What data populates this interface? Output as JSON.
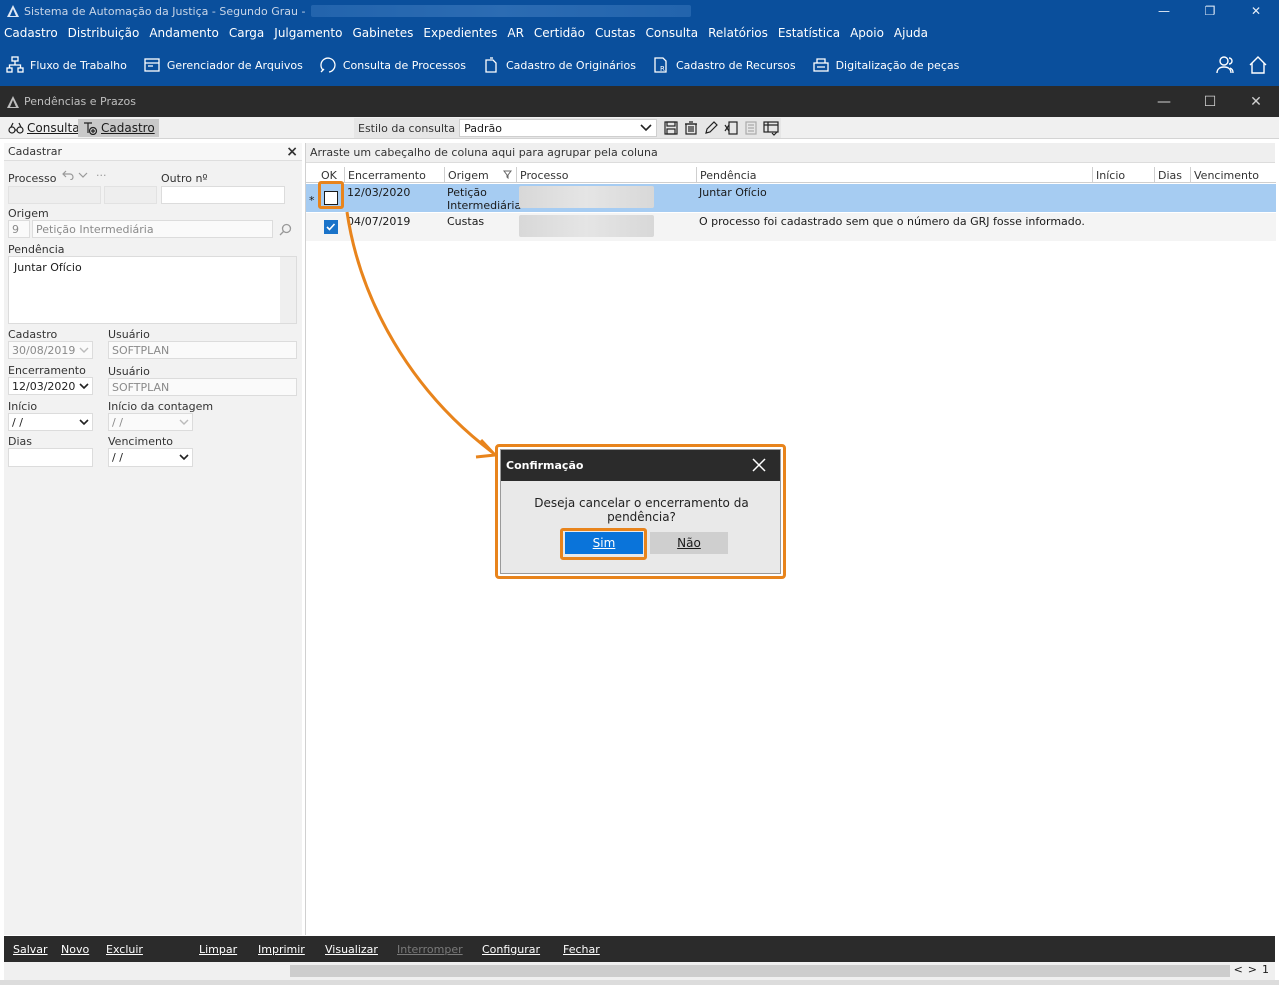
{
  "app": {
    "title": "Sistema de Automação da Justiça - Segundo Grau -",
    "window_controls": [
      "—",
      "❐",
      "✕"
    ]
  },
  "menu": [
    "Cadastro",
    "Distribuição",
    "Andamento",
    "Carga",
    "Julgamento",
    "Gabinetes",
    "Expedientes",
    "AR",
    "Certidão",
    "Custas",
    "Consulta",
    "Relatórios",
    "Estatística",
    "Apoio",
    "Ajuda"
  ],
  "toolbar": [
    {
      "label": "Fluxo de Trabalho",
      "icon": "workflow-icon"
    },
    {
      "label": "Gerenciador de Arquivos",
      "icon": "file-manager-icon"
    },
    {
      "label": "Consulta de Processos",
      "icon": "search-process-icon"
    },
    {
      "label": "Cadastro de Originários",
      "icon": "originarios-icon"
    },
    {
      "label": "Cadastro de Recursos",
      "icon": "recursos-icon"
    },
    {
      "label": "Digitalização de peças",
      "icon": "scanner-icon"
    }
  ],
  "child_window": {
    "title": "Pendências e Prazos",
    "controls": [
      "—",
      "☐",
      "✕"
    ]
  },
  "tabs": {
    "consulta": "Consulta",
    "cadastro": "Cadastro"
  },
  "style_bar": {
    "label": "Estilo da consulta",
    "value": "Padrão"
  },
  "left_panel": {
    "header": "Cadastrar",
    "close": "×",
    "processo_label": "Processo",
    "outro_label": "Outro nº",
    "origem_label": "Origem",
    "origem_code": "9",
    "origem_value": "Petição Intermediária",
    "pendencia_label": "Pendência",
    "pendencia_value": "Juntar Ofício",
    "cadastro_label": "Cadastro",
    "cadastro_value": "30/08/2019",
    "usuario_label": "Usuário",
    "usuario_value": "SOFTPLAN",
    "encerramento_label": "Encerramento",
    "encerramento_value": "12/03/2020",
    "usuario2_label": "Usuário",
    "usuario2_value": "SOFTPLAN",
    "inicio_label": "Início",
    "inicio_value": " / /",
    "inicio_contagem_label": "Início da contagem",
    "inicio_contagem_value": " / /",
    "dias_label": "Dias",
    "vencimento_label": "Vencimento",
    "vencimento_value": " / /"
  },
  "grid": {
    "group_hint": "Arraste um cabeçalho de coluna aqui para agrupar pela coluna",
    "columns": [
      "OK",
      "Encerramento",
      "Origem",
      "Processo",
      "Pendência",
      "Início",
      "Dias",
      "Vencimento"
    ],
    "rows": [
      {
        "marker": "*",
        "ok": false,
        "encerramento": "12/03/2020",
        "origem_l1": "Petição",
        "origem_l2": "Intermediária",
        "pendencia": "Juntar Ofício"
      },
      {
        "marker": "",
        "ok": true,
        "encerramento": "04/07/2019",
        "origem_l1": "Custas",
        "origem_l2": "",
        "pendencia": "O processo foi cadastrado sem que o número da GRJ fosse informado."
      }
    ]
  },
  "dialog": {
    "title": "Confirmação",
    "message": "Deseja cancelar o encerramento da pendência?",
    "yes": "Sim",
    "no": "Não"
  },
  "bottom_actions": [
    "Salvar",
    "Novo",
    "Excluir",
    "Limpar",
    "Imprimir",
    "Visualizar",
    "Interromper",
    "Configurar",
    "Fechar"
  ],
  "pager": {
    "prev": "<",
    "next": ">",
    "page": "1"
  },
  "colors": {
    "brand": "#0a4f9c",
    "highlight": "#e8841c",
    "dialog_primary": "#0a74da",
    "row_selected": "#a6ccf2"
  }
}
